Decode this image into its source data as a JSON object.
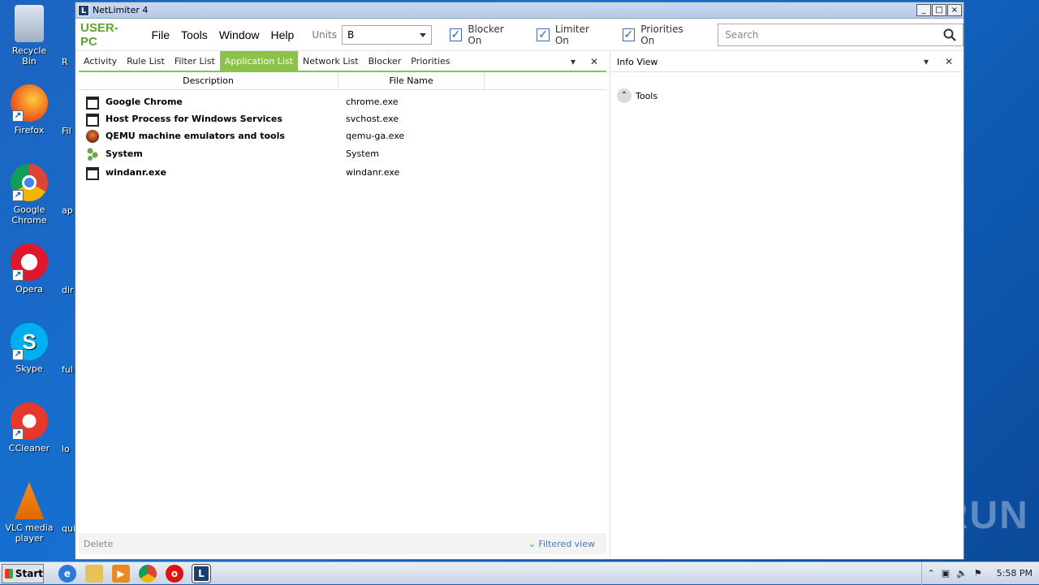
{
  "desktop": {
    "icons": [
      {
        "label": "Recycle Bin",
        "icon": "recycle-bin-icon"
      },
      {
        "label": "Firefox",
        "icon": "firefox-icon"
      },
      {
        "label": "Google Chrome",
        "icon": "chrome-icon"
      },
      {
        "label": "Opera",
        "icon": "opera-icon"
      },
      {
        "label": "Skype",
        "icon": "skype-icon"
      },
      {
        "label": "CCleaner",
        "icon": "ccleaner-icon"
      },
      {
        "label": "VLC media player",
        "icon": "vlc-icon"
      }
    ],
    "right_icons": [
      "R",
      "Fil",
      "ap",
      "dir",
      "ful",
      "lo",
      "qui"
    ],
    "watermark": "ANY RUN"
  },
  "window": {
    "title": "NetLimiter 4",
    "logo": "L",
    "controls": [
      "_",
      "□",
      "×"
    ]
  },
  "menubar": {
    "pc_name": "USER-PC",
    "menus": [
      "File",
      "Tools",
      "Window",
      "Help"
    ],
    "units_label": "Units",
    "units_value": "B",
    "checkboxes": [
      {
        "label": "Blocker On",
        "checked": true
      },
      {
        "label": "Limiter On",
        "checked": true
      },
      {
        "label": "Priorities On",
        "checked": true
      }
    ],
    "search_placeholder": "Search"
  },
  "left_panel": {
    "tabs": [
      "Activity",
      "Rule List",
      "Filter List",
      "Application List",
      "Network List",
      "Blocker",
      "Priorities"
    ],
    "active_tab": "Application List",
    "columns": [
      "Description",
      "File Name"
    ],
    "rows": [
      {
        "description": "Google Chrome",
        "file": "chrome.exe",
        "icon": "window-icon"
      },
      {
        "description": "Host Process for Windows Services",
        "file": "svchost.exe",
        "icon": "window-icon"
      },
      {
        "description": "QEMU machine emulators and tools",
        "file": "qemu-ga.exe",
        "icon": "qemu-icon"
      },
      {
        "description": "System",
        "file": "System",
        "icon": "system-icon"
      },
      {
        "description": "windanr.exe",
        "file": "windanr.exe",
        "icon": "window-icon"
      }
    ],
    "footer": {
      "delete": "Delete",
      "filtered_view": "Filtered view"
    }
  },
  "right_panel": {
    "title": "Info View",
    "section": "Tools"
  },
  "taskbar": {
    "start": "Start",
    "clock": "5:58 PM"
  },
  "colors": {
    "accent": "#8bc34a",
    "pc_name": "#5fa32e",
    "link": "#3a7fc4"
  }
}
